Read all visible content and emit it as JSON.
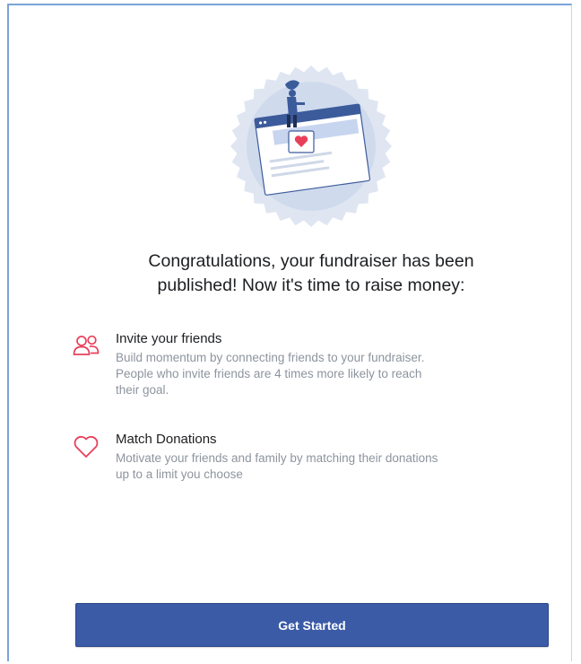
{
  "headline": {
    "line1": "Congratulations, your fundraiser has been",
    "line2": "published! Now it's time to raise money:"
  },
  "features": [
    {
      "icon": "people-icon",
      "title": "Invite your friends",
      "desc_lines": [
        "Build momentum by connecting friends to your fundraiser.",
        "People who invite friends are 4 times more likely to reach",
        "their goal."
      ]
    },
    {
      "icon": "heart-icon",
      "title": "Match Donations",
      "desc_lines": [
        "Motivate your friends and family by matching their donations",
        "up to a limit you choose"
      ]
    }
  ],
  "cta": {
    "label": "Get Started"
  },
  "colors": {
    "accent": "#3b5ba7",
    "icon_red": "#e8405a",
    "text_primary": "#1c1e21",
    "text_secondary": "#8d949e"
  }
}
